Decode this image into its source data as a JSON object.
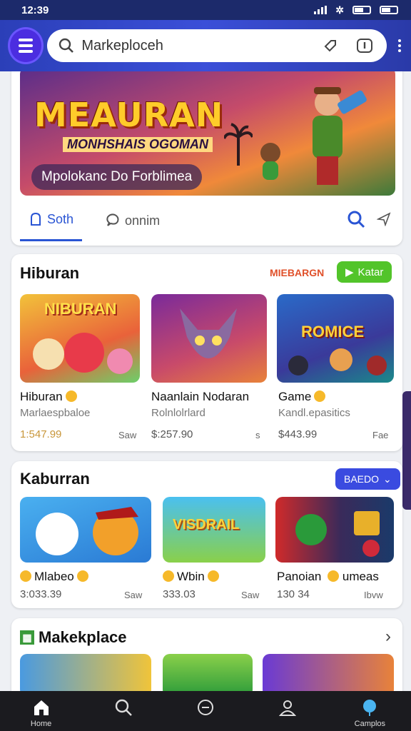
{
  "status": {
    "time": "12:39"
  },
  "search": {
    "text": "Markeploceh"
  },
  "hero": {
    "title": "MEAURAN",
    "subtitle": "MONHSHAIS OGOMAN",
    "tag": "Mpolokanc Do Forblimea"
  },
  "tabs": [
    {
      "label": "Soth"
    },
    {
      "label": "onnim"
    }
  ],
  "section1": {
    "title": "Hiburan",
    "link": "MIEBARGN",
    "button": "Katar",
    "items": [
      {
        "caption": "NIBURAN",
        "name": "Hiburan",
        "sub": "Marlaespbaloe",
        "price": "1:547.99",
        "right": "Saw"
      },
      {
        "caption": "",
        "name": "Naanlain Nodaran",
        "sub": "Rolnlolrlard",
        "price": "$:257.90",
        "right": "s"
      },
      {
        "caption": "ROMICE",
        "name": "Game",
        "sub": "Kandl.epasitics",
        "price": "$443.99",
        "right": "Fae"
      }
    ]
  },
  "section2": {
    "title": "Kaburran",
    "button": "BAEDO",
    "items": [
      {
        "caption": "",
        "name": "Mlabeo",
        "price": "3:033.39",
        "right": "Saw"
      },
      {
        "caption": "VISDRAIL",
        "name": "Wbin",
        "price": "333.03",
        "right": "Saw"
      },
      {
        "caption": "",
        "name": "Panoian",
        "name2": "umeas",
        "price": "130 34",
        "right": "Ibvw"
      }
    ]
  },
  "section3": {
    "title": "Makekplace"
  },
  "bottom_nav": [
    {
      "label": "Home",
      "icon": "home-icon"
    },
    {
      "label": "",
      "icon": "search-icon"
    },
    {
      "label": "",
      "icon": "minus-circle-icon"
    },
    {
      "label": "",
      "icon": "user-icon"
    },
    {
      "label": "Camplos",
      "icon": "balloon-icon"
    }
  ],
  "colors": {
    "brand": "#3b4fd8",
    "accent_green": "#52c42a",
    "accent_blue": "#3a4be0",
    "link_red": "#e0502a"
  }
}
